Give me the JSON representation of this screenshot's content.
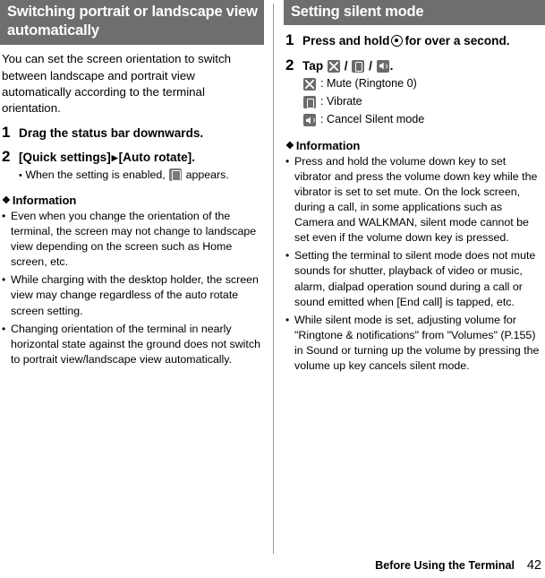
{
  "left": {
    "heading": "Switching portrait or landscape view automatically",
    "intro": "You can set the screen orientation to switch between landscape and portrait view automatically according to the terminal orientation.",
    "steps": [
      {
        "num": "1",
        "text": "Drag the status bar downwards.",
        "sub": ""
      },
      {
        "num": "2",
        "text_pre": "[Quick settings]",
        "text_post": "[Auto rotate].",
        "sub_pre": "When the setting is enabled,",
        "sub_post": "appears."
      }
    ],
    "info_heading": "Information",
    "info_items": [
      "Even when you change the orientation of the terminal, the screen may not change to landscape view depending on the screen such as Home screen, etc.",
      "While charging with the desktop holder, the screen view may change regardless of the auto rotate screen setting.",
      "Changing orientation of the terminal in nearly horizontal state against the ground does not switch to portrait view/landscape view automatically."
    ]
  },
  "right": {
    "heading": "Setting silent mode",
    "steps": [
      {
        "num": "1",
        "text_pre": "Press and hold",
        "text_post": "for over a second."
      },
      {
        "num": "2",
        "text_pre": "Tap",
        "sep1": "/",
        "sep2": "/",
        "text_post": "."
      }
    ],
    "icon_lines": [
      {
        "icon": "mute-icon",
        "label": ": Mute (Ringtone 0)"
      },
      {
        "icon": "vibrate-icon",
        "label": ": Vibrate"
      },
      {
        "icon": "sound-icon",
        "label": ": Cancel Silent mode"
      }
    ],
    "info_heading": "Information",
    "info_items": [
      "Press and hold the volume down key to set vibrator and press the volume down key while the vibrator is set to set mute. On the lock screen, during a call, in some applications such as Camera and WALKMAN, silent mode cannot be set even if the volume down key is pressed.",
      "Setting the terminal to silent mode does not mute sounds for shutter, playback of video or music, alarm, dialpad operation sound during a call or sound emitted when [End call] is tapped, etc.",
      "While silent mode is set, adjusting volume for \"Ringtone & notifications\" from \"Volumes\" (P.155) in Sound or turning up the volume by pressing the volume up key cancels silent mode."
    ]
  },
  "footer": {
    "label": "Before Using the Terminal",
    "page": "42"
  }
}
